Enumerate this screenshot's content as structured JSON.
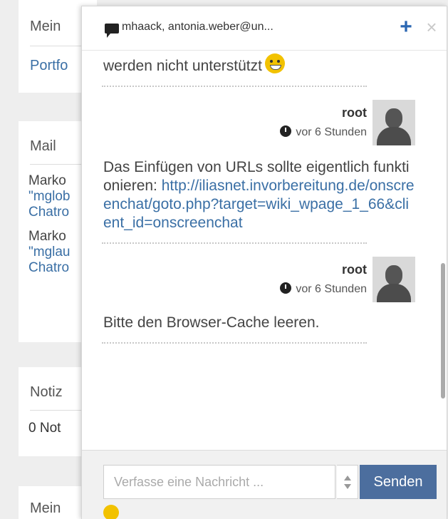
{
  "background": {
    "panel1": {
      "heading": "Mein",
      "link": "Portfo"
    },
    "mail": {
      "heading": "Mail",
      "entries": [
        {
          "name": "Marko",
          "quote": "\"mglob",
          "text": "Chatro"
        },
        {
          "name": "Marko",
          "quote": "\"mglau",
          "text": "Chatro"
        }
      ]
    },
    "notes": {
      "heading": "Notiz",
      "text": "0 Not"
    },
    "panel4": {
      "heading": "Mein"
    }
  },
  "chat": {
    "title": "mhaack, antonia.weber@un...",
    "add_icon": "plus-icon",
    "close_icon": "close-icon",
    "messages": [
      {
        "text": "werden nicht unterstützt",
        "emoji": "smiley-icon"
      },
      {
        "author": "root",
        "time": "vor 6 Stunden",
        "text_before": "Das Einfügen von URLs sollte eigentlich funktionieren: ",
        "url": "http://iliasnet.invorbereitung.de/onscreenchat/goto.php?target=wiki_wpage_1_66&client_id=onscreenchat"
      },
      {
        "author": "root",
        "time": "vor 6 Stunden",
        "text": "Bitte den Browser-Cache leeren."
      }
    ],
    "input": {
      "placeholder": "Verfasse eine Nachricht ...",
      "value": ""
    },
    "send_label": "Senden",
    "colors": {
      "accent": "#4c6e9e",
      "link": "#3a6fa5",
      "add": "#2a66b2"
    }
  }
}
